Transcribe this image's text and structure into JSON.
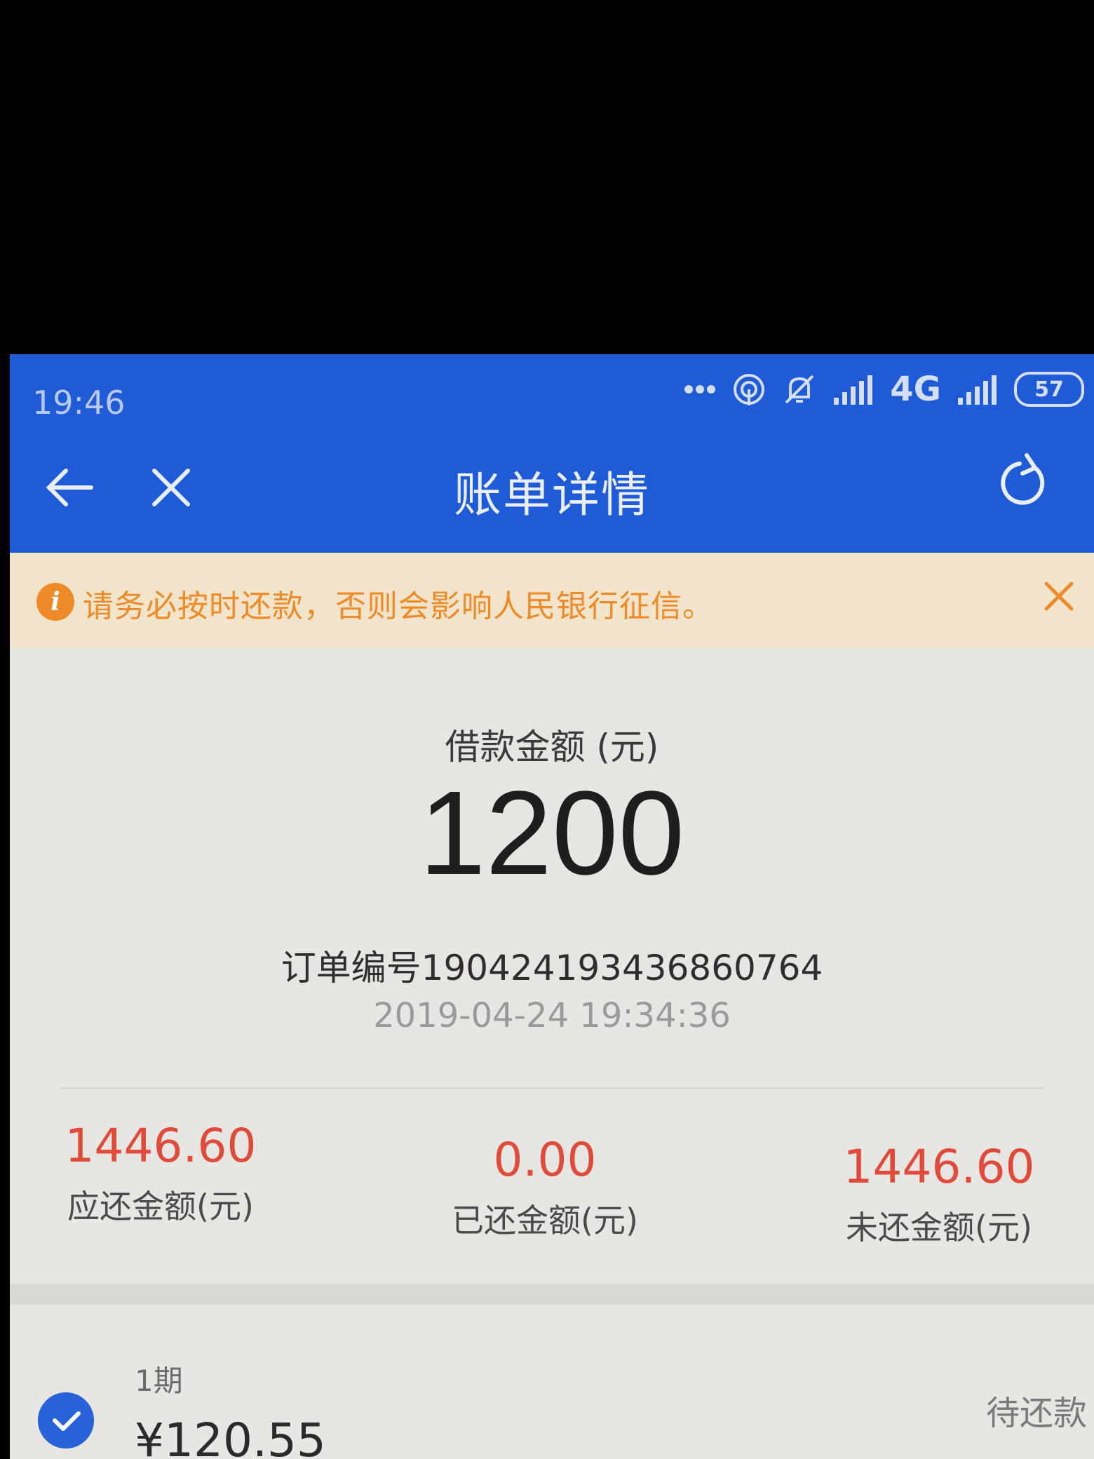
{
  "status_bar": {
    "time": "19:46",
    "network": "4G",
    "battery": "57"
  },
  "nav": {
    "title": "账单详情"
  },
  "notice": {
    "text": "请务必按时还款，否则会影响人民银行征信。"
  },
  "loan": {
    "label": "借款金额 (元)",
    "amount": "1200",
    "order_number": "订单编号190424193436860764",
    "order_time": "2019-04-24 19:34:36"
  },
  "summary": [
    {
      "value": "1446.60",
      "label": "应还金额(元)"
    },
    {
      "value": "0.00",
      "label": "已还金额(元)"
    },
    {
      "value": "1446.60",
      "label": "未还金额(元)"
    }
  ],
  "installment": {
    "period": "1期",
    "amount": "¥120.55",
    "status": "待还款"
  },
  "colors": {
    "header_blue": "#1f5bd6",
    "notice_bg": "#f1e4cb",
    "notice_orange": "#ee8b28",
    "amount_red": "#e04a3a"
  }
}
